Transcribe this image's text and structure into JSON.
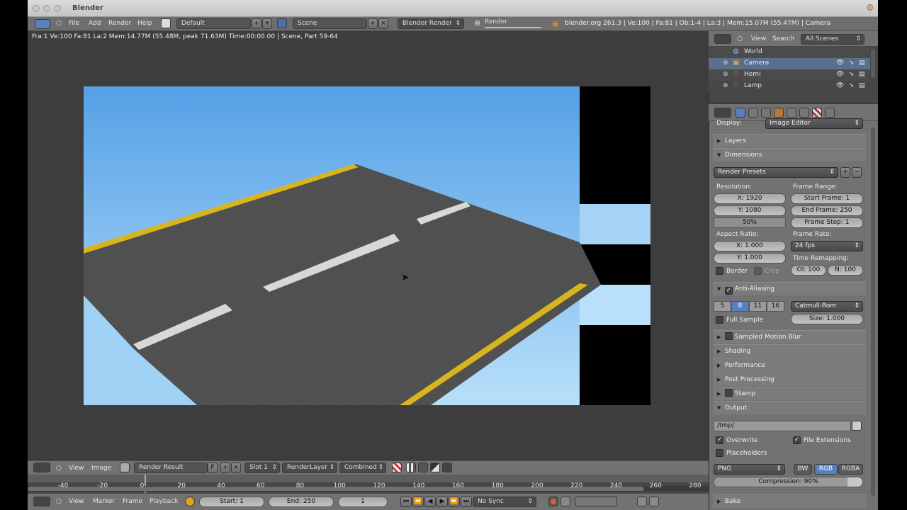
{
  "window": {
    "title": "Blender"
  },
  "info_header": {
    "menus": [
      "File",
      "Add",
      "Render",
      "Help"
    ],
    "screen_layout": "Default",
    "scene": "Scene",
    "engine": "Blender Render",
    "render_job": "Render",
    "stats": "blender.org 261.3 | Ve:100 | Fa:81 | Ob:1-4 | La:3 | Mem:15.07M (55.47M) | Camera"
  },
  "image_editor": {
    "status_line": "Fra:1  Ve:100 Fa:81 La:2 Mem:14.77M (55.48M, peak 71.63M) Time:00:00.00 | Scene, Part 59-64",
    "header": {
      "menus": [
        "View",
        "Image"
      ],
      "image_name": "Render Result",
      "fake_user": "F",
      "slot": "Slot 1",
      "layer": "RenderLayer",
      "pass": "Combined"
    }
  },
  "timeline": {
    "ticks": [
      "-40",
      "-20",
      "0",
      "20",
      "40",
      "60",
      "80",
      "100",
      "120",
      "140",
      "160",
      "180",
      "200",
      "220",
      "240",
      "260",
      "280"
    ],
    "current_frame_marker": 1,
    "footer": {
      "menus": [
        "View",
        "Marker",
        "Frame",
        "Playback"
      ],
      "start": "Start: 1",
      "end": "End: 250",
      "current": "1",
      "sync": "No Sync"
    }
  },
  "outliner": {
    "view_menu": "View",
    "search_menu": "Search",
    "filter": "All Scenes",
    "items": [
      "World",
      "Camera",
      "Hemi",
      "Lamp"
    ]
  },
  "properties": {
    "display_label": "Display:",
    "display_value": "Image Editor",
    "panels": {
      "layers": "Layers",
      "dimensions": "Dimensions",
      "render_presets": "Render Presets",
      "resolution_label": "Resolution:",
      "res_x": "X: 1920",
      "res_y": "Y: 1080",
      "res_pct": "50%",
      "frame_range_label": "Frame Range:",
      "start_frame": "Start Frame: 1",
      "end_frame": "End Frame: 250",
      "frame_step": "Frame Step: 1",
      "aspect_label": "Aspect Ratio:",
      "aspect_x": "X: 1.000",
      "aspect_y": "Y: 1.000",
      "frame_rate_label": "Frame Rate:",
      "frame_rate": "24 fps",
      "time_remap_label": "Time Remapping:",
      "remap_old": "Ol: 100",
      "remap_new": "N: 100",
      "border": "Border",
      "crop": "Crop",
      "anti_aliasing": "Anti-Aliasing",
      "aa_samples": [
        "5",
        "8",
        "11",
        "16"
      ],
      "aa_selected": "8",
      "aa_filter": "Catmull-Rom",
      "full_sample": "Full Sample",
      "aa_size": "Size: 1.000",
      "sampled_motion_blur": "Sampled Motion Blur",
      "shading": "Shading",
      "performance": "Performance",
      "post_processing": "Post Processing",
      "stamp": "Stamp",
      "output": "Output",
      "output_path": "/tmp/",
      "overwrite": "Overwrite",
      "file_extensions": "File Extensions",
      "placeholders": "Placeholders",
      "file_format": "PNG",
      "color_modes": [
        "BW",
        "RGB",
        "RGBA"
      ],
      "color_selected": "RGB",
      "compression": "Compression: 90%",
      "bake": "Bake"
    }
  },
  "colors": {
    "accent_blue": "#5680c2",
    "sky_top": "#5ba3e6",
    "sky_bottom": "#b3ddf9",
    "asphalt": "#3c3c3c",
    "road_yellow": "#d8b51e"
  }
}
